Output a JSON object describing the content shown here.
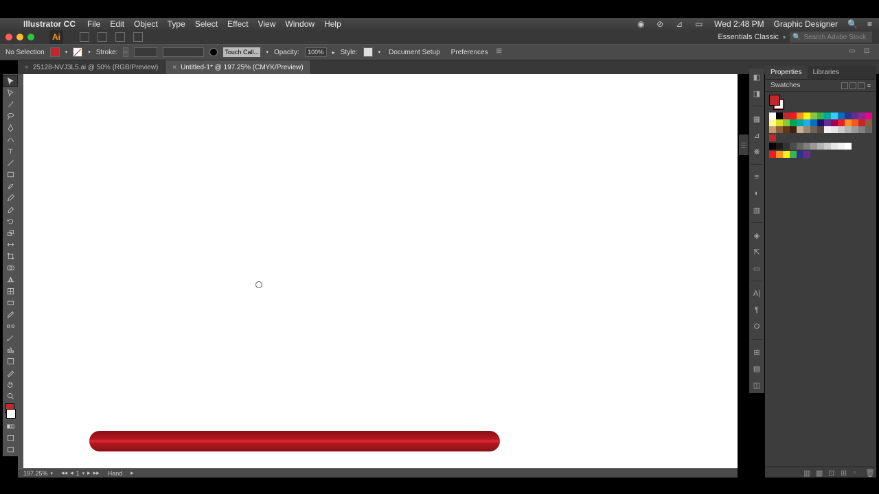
{
  "mac_menu": {
    "app": "Illustrator CC",
    "items": [
      "File",
      "Edit",
      "Object",
      "Type",
      "Select",
      "Effect",
      "View",
      "Window",
      "Help"
    ],
    "clock": "Wed 2:48 PM",
    "user": "Graphic Designer"
  },
  "workspace": {
    "name": "Essentials Classic",
    "search_placeholder": "Search Adobe Stock"
  },
  "control_bar": {
    "selection": "No Selection",
    "stroke_label": "Stroke:",
    "touch": "Touch Call...",
    "opacity_label": "Opacity:",
    "opacity_value": "100%",
    "style_label": "Style:",
    "doc_setup": "Document Setup",
    "prefs": "Preferences"
  },
  "tabs": [
    {
      "label": "25128-NVJ3L5.ai @ 50% (RGB/Preview)",
      "active": false
    },
    {
      "label": "Untitled-1* @ 197.25% (CMYK/Preview)",
      "active": true
    }
  ],
  "status": {
    "zoom": "197.25%",
    "page": "1",
    "tool": "Hand"
  },
  "panels": {
    "properties": "Properties",
    "libraries": "Libraries",
    "swatches": "Swatches"
  },
  "swatches_row1": [
    "#ffffff",
    "#000000",
    "#c1272d",
    "#ed1c24",
    "#f7931e",
    "#fff200",
    "#8cc63f",
    "#39b54a",
    "#00a99d",
    "#33ccff",
    "#0071bc",
    "#2e3192",
    "#662d91",
    "#93278f",
    "#ec008c"
  ],
  "swatches_row1b": [
    "#fff799",
    "#d9e021",
    "#8cc63f",
    "#00a651",
    "#00a99d",
    "#29abe2",
    "#0071bc",
    "#1b1464",
    "#662d91",
    "#9e005d",
    "#ed1c24",
    "#f7931e",
    "#f15a24",
    "#c1272d",
    "#8b5e3c"
  ],
  "swatches_row2": [
    "#c69c6d",
    "#8b5e3c",
    "#603813",
    "#42210b",
    "#c7b299",
    "#998675",
    "#736357",
    "#534741",
    "#f2f2f2",
    "#e6e6e6",
    "#cccccc",
    "#b3b3b3",
    "#999999",
    "#808080",
    "#666666"
  ],
  "swatches_extra": [
    "#c1272d"
  ],
  "grays": [
    "#000000",
    "#1a1a1a",
    "#333333",
    "#4d4d4d",
    "#666666",
    "#808080",
    "#999999",
    "#b3b3b3",
    "#cccccc",
    "#e6e6e6",
    "#f2f2f2",
    "#ffffff"
  ],
  "accent_row": [
    "#ed1c24",
    "#f7931e",
    "#fcee21",
    "#39b54a",
    "#2e3192",
    "#662d91"
  ]
}
